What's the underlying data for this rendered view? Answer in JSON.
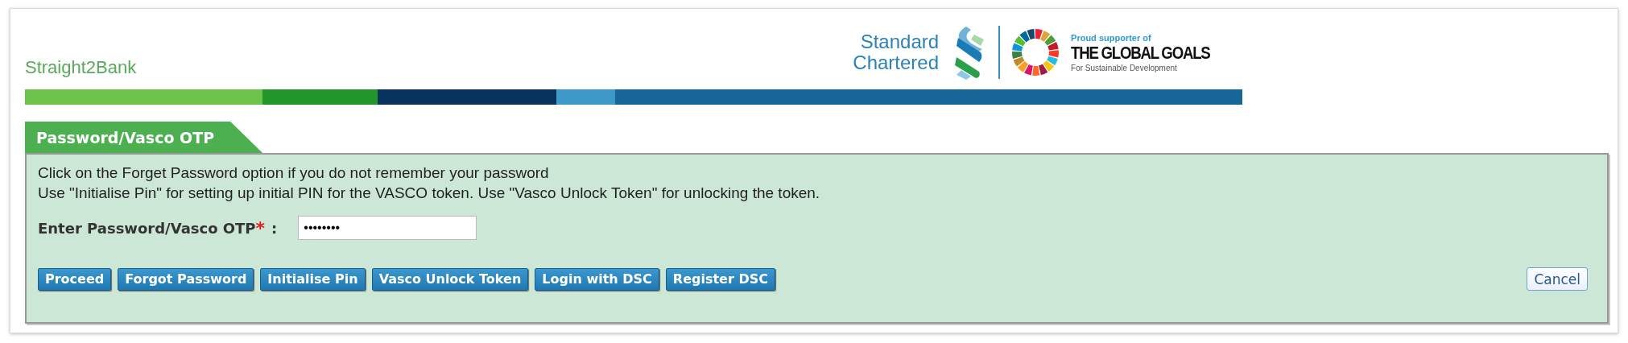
{
  "header": {
    "app_name": "Straight2Bank",
    "brand": {
      "line_1": "Standard",
      "line_2": "Chartered"
    },
    "goals": {
      "kicker": "Proud supporter of",
      "title": "THE GLOBAL GOALS",
      "subtitle": "For Sustainable Development"
    }
  },
  "tab": {
    "label": "Password/Vasco OTP",
    "selected": true
  },
  "instructions": [
    "Click on the Forget Password option if you do not remember your password",
    "Use \"Initialise Pin\" for setting up initial PIN for the VASCO token. Use \"Vasco Unlock Token\" for unlocking the token."
  ],
  "password_field": {
    "label": "Enter Password/Vasco OTP",
    "required_mark": "*",
    "colon": ":",
    "value": "••••••••"
  },
  "buttons": [
    "Proceed",
    "Forgot Password",
    "Initialise Pin",
    "Vasco Unlock Token",
    "Login with DSC",
    "Register DSC"
  ],
  "cancel_button": "Cancel"
}
